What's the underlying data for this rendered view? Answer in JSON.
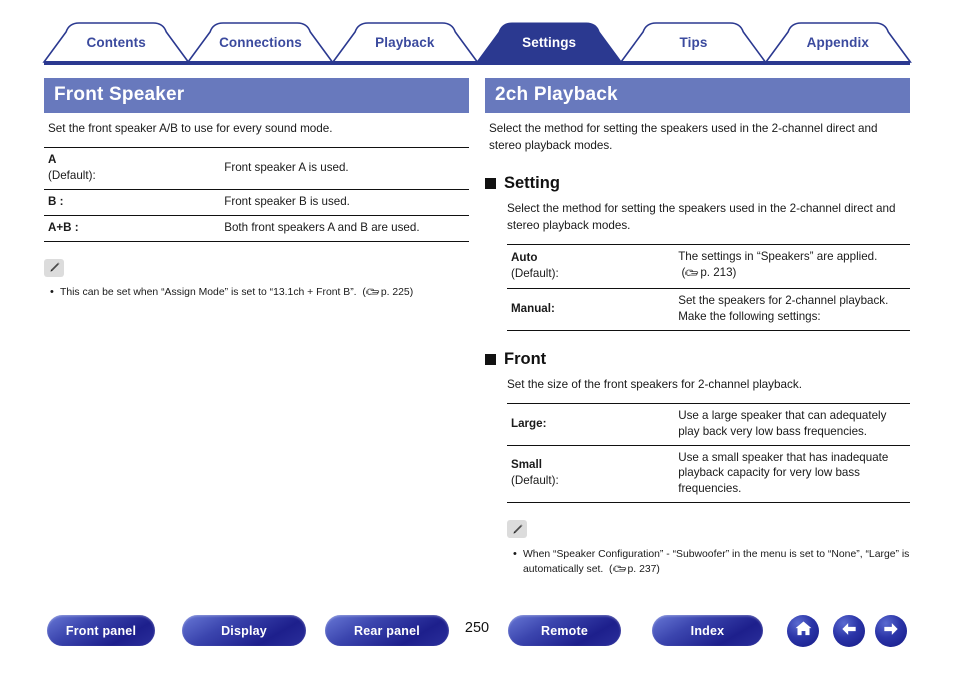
{
  "tabs": [
    {
      "label": "Contents",
      "active": false
    },
    {
      "label": "Connections",
      "active": false
    },
    {
      "label": "Playback",
      "active": false
    },
    {
      "label": "Settings",
      "active": true
    },
    {
      "label": "Tips",
      "active": false
    },
    {
      "label": "Appendix",
      "active": false
    }
  ],
  "left": {
    "header": "Front Speaker",
    "intro": "Set the front speaker A/B to use for every sound mode.",
    "table": [
      {
        "term": "A",
        "term_sub": "(Default):",
        "desc": "Front speaker A is used."
      },
      {
        "term": "B :",
        "term_sub": "",
        "desc": "Front speaker B is used."
      },
      {
        "term": "A+B :",
        "term_sub": "",
        "desc": "Both front speakers A and B are used."
      }
    ],
    "note": {
      "icon": "pencil-icon",
      "text": "This can be set when “Assign Mode” is set to “13.1ch + Front B”.",
      "ref": "p. 225"
    }
  },
  "right": {
    "header": "2ch Playback",
    "intro": "Select the method for setting the speakers used in the 2-channel direct and stereo playback modes.",
    "setting": {
      "heading": "Setting",
      "intro": "Select the method for setting the speakers used in the 2-channel direct and stereo playback modes.",
      "table": [
        {
          "term": "Auto",
          "term_sub": "(Default):",
          "desc": "The settings in “Speakers” are applied.",
          "ref": "p. 213"
        },
        {
          "term": "Manual:",
          "term_sub": "",
          "desc": "Set the speakers for 2-channel playback. Make the following settings:",
          "ref": ""
        }
      ]
    },
    "front": {
      "heading": "Front",
      "intro": "Set the size of the front speakers for 2-channel playback.",
      "table": [
        {
          "term": "Large:",
          "term_sub": "",
          "desc": "Use a large speaker that can adequately play back very low bass frequencies."
        },
        {
          "term": "Small",
          "term_sub": "(Default):",
          "desc": "Use a small speaker that has inadequate playback capacity for very low bass frequencies."
        }
      ]
    },
    "note": {
      "icon": "pencil-icon",
      "text": "When “Speaker Configuration” - “Subwoofer” in the menu is set to “None”, “Large” is automatically set.",
      "ref": "p. 237"
    }
  },
  "bottom": {
    "buttons": [
      {
        "label": "Front panel"
      },
      {
        "label": "Display"
      },
      {
        "label": "Rear panel"
      },
      {
        "label": "Remote"
      },
      {
        "label": "Index"
      }
    ],
    "page_number": "250",
    "icons": [
      {
        "name": "home-icon"
      },
      {
        "name": "arrow-left-icon"
      },
      {
        "name": "arrow-right-icon"
      }
    ]
  },
  "colors": {
    "section_header": "#6879bd",
    "tab_active": "#2b3990",
    "tab_text": "#3b4a9e",
    "baseline": "#2b3990"
  }
}
